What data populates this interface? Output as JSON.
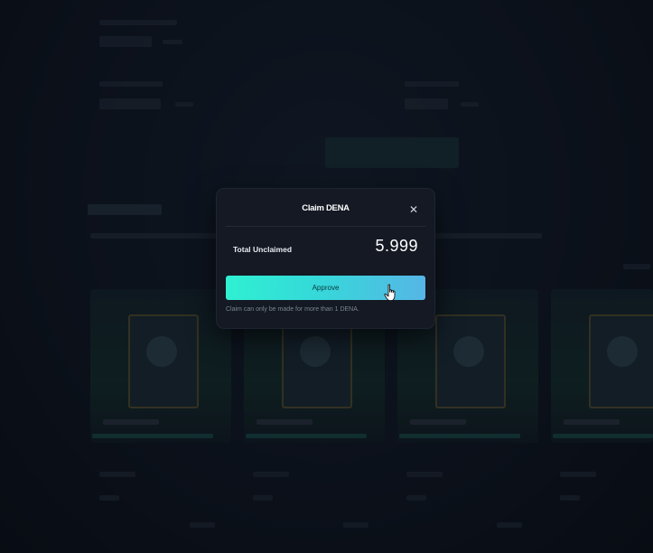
{
  "modal": {
    "title": "Claim DENA",
    "close_icon": "close-icon",
    "total_unclaimed_label": "Total Unclaimed",
    "total_unclaimed_value": "5.999",
    "approve_label": "Approve",
    "note": "Claim can only be made for more than 1 DENA."
  },
  "colors": {
    "modal_bg": "#141923",
    "approve_gradient_start": "#2ff0d2",
    "approve_gradient_end": "#56b6e6",
    "page_bg": "#111722"
  },
  "cursor_icon": "hand-pointer-icon"
}
